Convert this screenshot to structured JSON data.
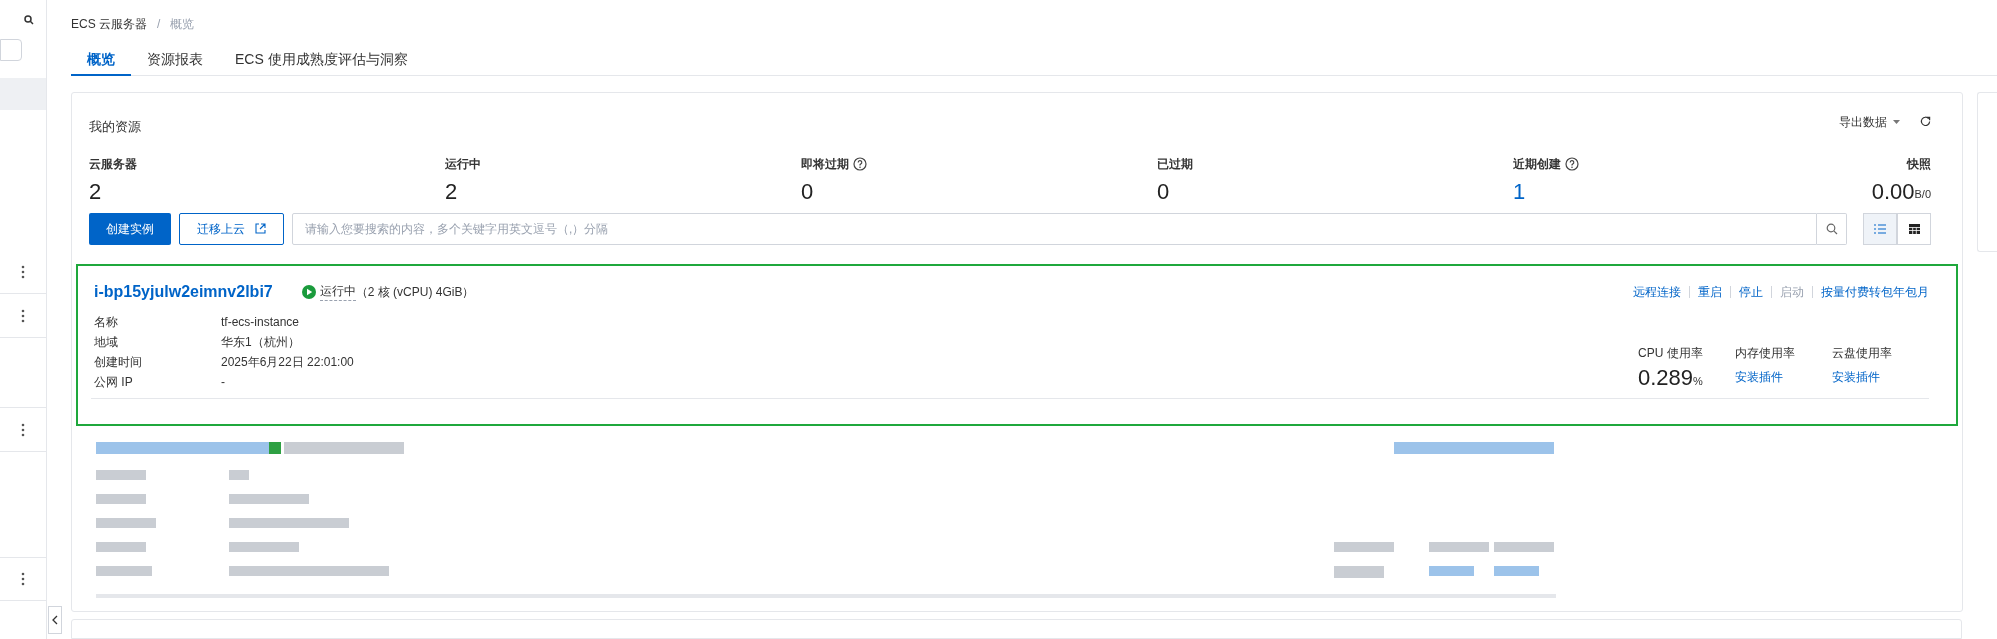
{
  "breadcrumb": {
    "items": [
      "ECS 云服务器",
      "概览"
    ],
    "separator": "/"
  },
  "tabs": [
    {
      "label": "概览",
      "selected": true
    },
    {
      "label": "资源报表",
      "selected": false
    },
    {
      "label": "ECS 使用成熟度评估与洞察",
      "selected": false
    }
  ],
  "resources": {
    "title": "我的资源",
    "export_label": "导出数据",
    "stats": [
      {
        "label": "云服务器",
        "value": "2",
        "help": false,
        "link": false
      },
      {
        "label": "运行中",
        "value": "2",
        "help": false,
        "link": false
      },
      {
        "label": "即将过期",
        "value": "0",
        "help": true,
        "link": false
      },
      {
        "label": "已过期",
        "value": "0",
        "help": false,
        "link": false
      },
      {
        "label": "近期创建",
        "value": "1",
        "help": true,
        "link": true
      },
      {
        "label": "快照",
        "value": "0.00",
        "unit": "B/0",
        "help": false,
        "link": false
      }
    ],
    "create_button": "创建实例",
    "migrate_button": "迁移上云",
    "search": {
      "placeholder": "请输入您要搜索的内容，多个关键字用英文逗号（,）分隔"
    },
    "views": [
      {
        "kind": "list",
        "selected": true
      },
      {
        "kind": "grid",
        "selected": false
      }
    ]
  },
  "instance": {
    "id": "i-bp15yjulw2eimnv2lbi7",
    "status": "运行中",
    "spec": "（2 核 (vCPU) 4GiB）",
    "highlighted": true,
    "actions": [
      {
        "label": "远程连接",
        "disabled": false
      },
      {
        "label": "重启",
        "disabled": false
      },
      {
        "label": "停止",
        "disabled": false
      },
      {
        "label": "启动",
        "disabled": true
      },
      {
        "label": "按量付费转包年包月",
        "disabled": false
      }
    ],
    "fields": [
      {
        "label": "名称",
        "value": "tf-ecs-instance"
      },
      {
        "label": "地域",
        "value": "华东1（杭州）"
      },
      {
        "label": "创建时间",
        "value": "2025年6月22日 22:01:00"
      },
      {
        "label": "公网 IP",
        "value": "-"
      }
    ],
    "metrics": [
      {
        "kind": "value",
        "label": "CPU 使用率",
        "value": "0.289",
        "unit": "%"
      },
      {
        "kind": "link",
        "label": "内存使用率",
        "value": "安装插件"
      },
      {
        "kind": "link",
        "label": "云盘使用率",
        "value": "安装插件"
      }
    ]
  }
}
